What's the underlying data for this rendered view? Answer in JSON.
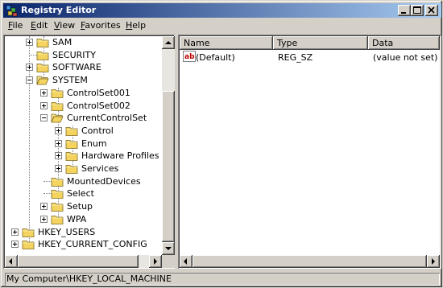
{
  "window": {
    "title": "Registry Editor",
    "controls": [
      "minimize",
      "maximize",
      "close"
    ]
  },
  "menu": [
    {
      "label": "File",
      "accel": "F",
      "rest": "ile"
    },
    {
      "label": "Edit",
      "accel": "E",
      "rest": "dit"
    },
    {
      "label": "View",
      "accel": "V",
      "rest": "iew"
    },
    {
      "label": "Favorites",
      "accel": "F",
      "rest": "avorites"
    },
    {
      "label": "Help",
      "accel": "H",
      "rest": "elp"
    }
  ],
  "tree": [
    {
      "label": "SAM",
      "depth": 0,
      "expander": "plus"
    },
    {
      "label": "SECURITY",
      "depth": 0,
      "expander": "none"
    },
    {
      "label": "SOFTWARE",
      "depth": 0,
      "expander": "plus"
    },
    {
      "label": "SYSTEM",
      "depth": 0,
      "expander": "minus"
    },
    {
      "label": "ControlSet001",
      "depth": 1,
      "expander": "plus"
    },
    {
      "label": "ControlSet002",
      "depth": 1,
      "expander": "plus"
    },
    {
      "label": "CurrentControlSet",
      "depth": 1,
      "expander": "minus"
    },
    {
      "label": "Control",
      "depth": 2,
      "expander": "plus"
    },
    {
      "label": "Enum",
      "depth": 2,
      "expander": "plus"
    },
    {
      "label": "Hardware Profiles",
      "depth": 2,
      "expander": "plus"
    },
    {
      "label": "Services",
      "depth": 2,
      "expander": "plus"
    },
    {
      "label": "MountedDevices",
      "depth": 1,
      "expander": "none"
    },
    {
      "label": "Select",
      "depth": 1,
      "expander": "none"
    },
    {
      "label": "Setup",
      "depth": 1,
      "expander": "plus"
    },
    {
      "label": "WPA",
      "depth": 1,
      "expander": "plus"
    },
    {
      "label": "HKEY_USERS",
      "depth": -1,
      "expander": "plus"
    },
    {
      "label": "HKEY_CURRENT_CONFIG",
      "depth": -1,
      "expander": "plus"
    }
  ],
  "list": {
    "columns": [
      "Name",
      "Type",
      "Data"
    ],
    "rows": [
      {
        "icon": "string-value-icon",
        "name": "(Default)",
        "type": "REG_SZ",
        "data": "(value not set)"
      }
    ]
  },
  "status": {
    "path": "My Computer\\HKEY_LOCAL_MACHINE"
  },
  "colors": {
    "titlebar_start": "#0a246a",
    "titlebar_end": "#a6caf0",
    "face": "#d4d0c8",
    "folder": "#f4d35e"
  }
}
